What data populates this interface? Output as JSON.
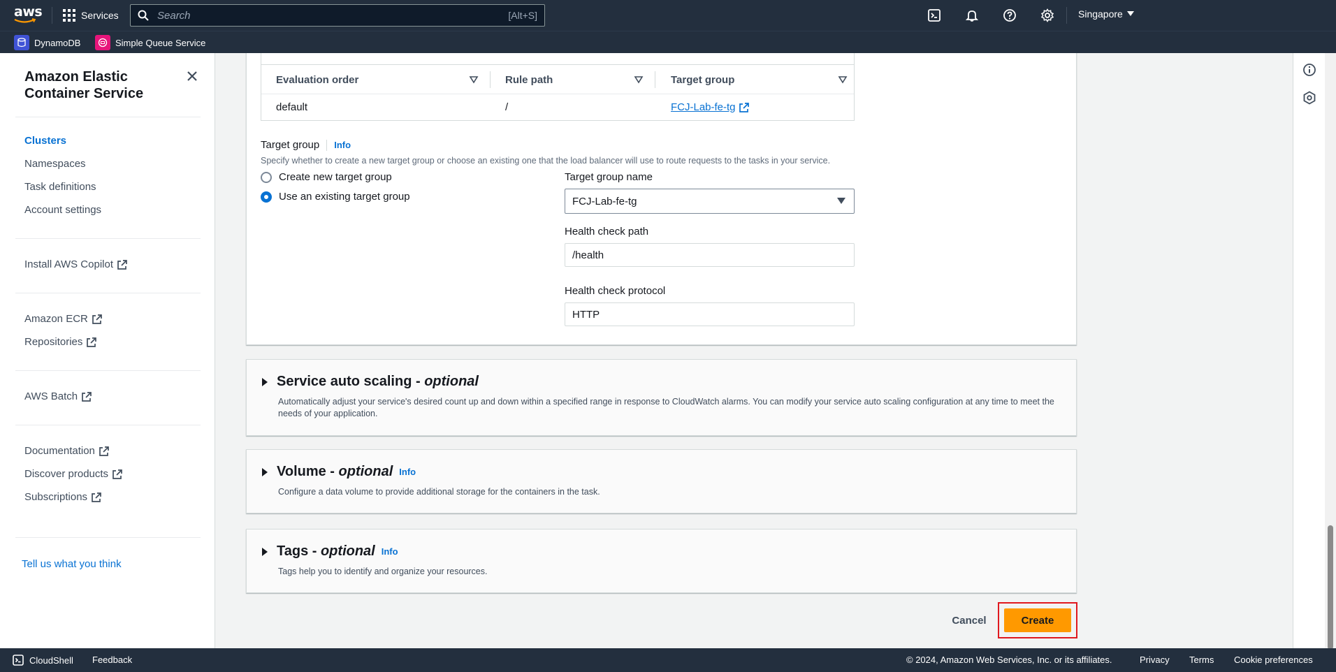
{
  "topnav": {
    "logo_text": "aws",
    "services_label": "Services",
    "search_placeholder": "Search",
    "search_shortcut": "[Alt+S]",
    "region": "Singapore"
  },
  "favorites": [
    {
      "label": "DynamoDB",
      "color": "#4053d6"
    },
    {
      "label": "Simple Queue Service",
      "color": "#e7157b"
    }
  ],
  "sidebar": {
    "title": "Amazon Elastic Container Service",
    "nav": [
      {
        "label": "Clusters",
        "active": true
      },
      {
        "label": "Namespaces"
      },
      {
        "label": "Task definitions"
      },
      {
        "label": "Account settings"
      }
    ],
    "copilot": "Install AWS Copilot",
    "ecr": "Amazon ECR",
    "repositories": "Repositories",
    "batch": "AWS Batch",
    "documentation": "Documentation",
    "discover": "Discover products",
    "subscriptions": "Subscriptions",
    "feedback": "Tell us what you think"
  },
  "rules_table": {
    "headers": [
      "Evaluation order",
      "Rule path",
      "Target group"
    ],
    "row": {
      "order": "default",
      "path": "/",
      "target": "FCJ-Lab-fe-tg"
    }
  },
  "target_group": {
    "label": "Target group",
    "info": "Info",
    "description": "Specify whether to create a new target group or choose an existing one that the load balancer will use to route requests to the tasks in your service.",
    "option_new": "Create new target group",
    "option_existing": "Use an existing target group",
    "selected": "existing",
    "name_label": "Target group name",
    "name_value": "FCJ-Lab-fe-tg",
    "health_path_label": "Health check path",
    "health_path_value": "/health",
    "health_protocol_label": "Health check protocol",
    "health_protocol_value": "HTTP"
  },
  "sections": {
    "autoscaling": {
      "title": "Service auto scaling - ",
      "optional": "optional",
      "description": "Automatically adjust your service's desired count up and down within a specified range in response to CloudWatch alarms. You can modify your service auto scaling configuration at any time to meet the needs of your application."
    },
    "volume": {
      "title": "Volume - ",
      "optional": "optional",
      "info": "Info",
      "description": "Configure a data volume to provide additional storage for the containers in the task."
    },
    "tags": {
      "title": "Tags - ",
      "optional": "optional",
      "info": "Info",
      "description": "Tags help you to identify and organize your resources."
    }
  },
  "actions": {
    "cancel": "Cancel",
    "create": "Create"
  },
  "footer": {
    "cloudshell": "CloudShell",
    "feedback": "Feedback",
    "copyright": "© 2024, Amazon Web Services, Inc. or its affiliates.",
    "privacy": "Privacy",
    "terms": "Terms",
    "cookies": "Cookie preferences"
  },
  "colors": {
    "nav_bg": "#232f3e",
    "link": "#0972d3",
    "primary_button": "#ff9900",
    "highlight_box": "#e0191f"
  }
}
